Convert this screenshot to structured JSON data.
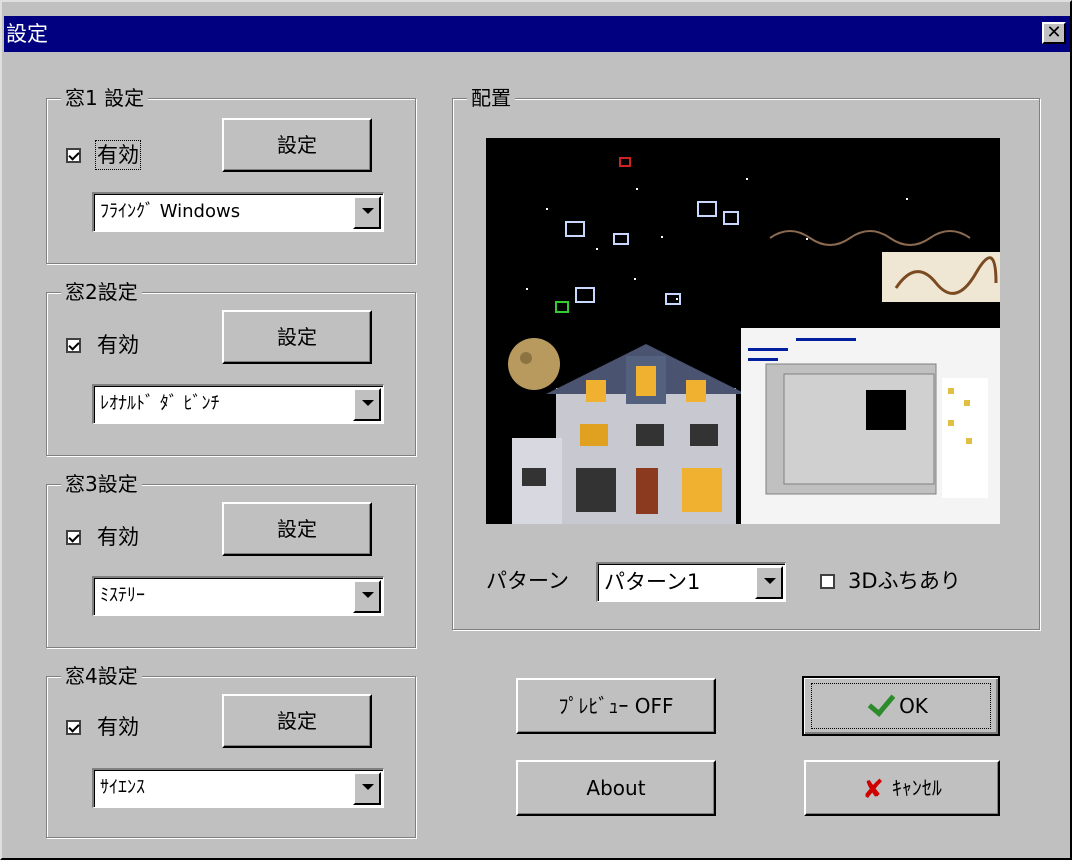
{
  "window": {
    "title": "設定",
    "close_glyph": "✕"
  },
  "panels": [
    {
      "legend": "窓1 設定",
      "enabled_label": "有効",
      "enabled": true,
      "button_label": "設定",
      "selected": "ﾌﾗｲﾝｸﾞ Windows"
    },
    {
      "legend": "窓2設定",
      "enabled_label": "有効",
      "enabled": true,
      "button_label": "設定",
      "selected": "ﾚｵﾅﾙﾄﾞ ﾀﾞ ﾋﾞﾝﾁ"
    },
    {
      "legend": "窓3設定",
      "enabled_label": "有効",
      "enabled": true,
      "button_label": "設定",
      "selected": "ﾐｽﾃﾘｰ"
    },
    {
      "legend": "窓4設定",
      "enabled_label": "有効",
      "enabled": true,
      "button_label": "設定",
      "selected": "ｻｲｴﾝｽ"
    }
  ],
  "layout": {
    "legend": "配置",
    "pattern_label": "パターン",
    "pattern_value": "パターン1",
    "frame_label": "3Dふちあり",
    "frame_checked": false
  },
  "buttons": {
    "preview": "ﾌﾟﾚﾋﾞｭｰ OFF",
    "ok": "OK",
    "about": "About",
    "cancel": "ｷｬﾝｾﾙ"
  },
  "colors": {
    "titlebar": "#000080",
    "face": "#c0c0c0",
    "ok_check": "#2c8c2c",
    "cancel_x": "#d00000"
  }
}
